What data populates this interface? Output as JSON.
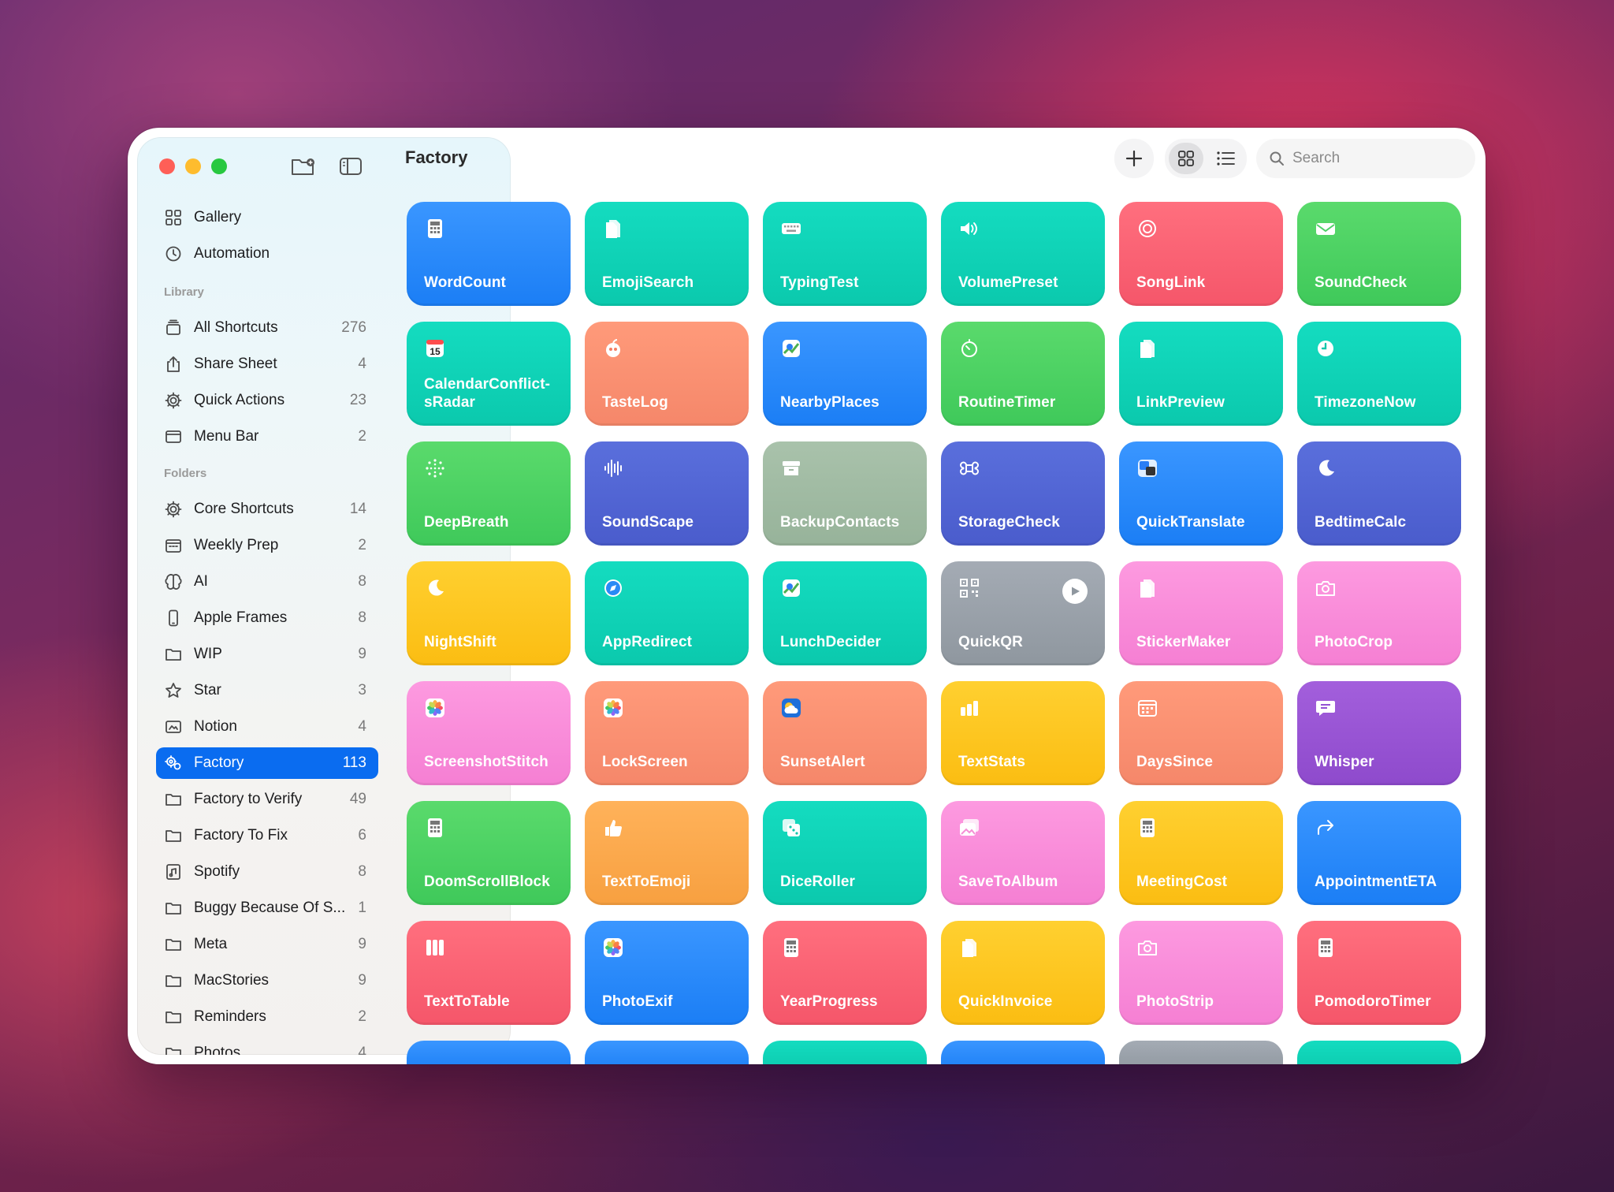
{
  "window": {
    "title": "Factory"
  },
  "toolbar": {
    "search_placeholder": "Search"
  },
  "sidebar": {
    "top": [
      {
        "label": "Gallery",
        "icon": "gallery-icon"
      },
      {
        "label": "Automation",
        "icon": "automation-icon"
      }
    ],
    "library_header": "Library",
    "library": [
      {
        "label": "All Shortcuts",
        "count": "276",
        "icon": "stack-icon"
      },
      {
        "label": "Share Sheet",
        "count": "4",
        "icon": "share-icon"
      },
      {
        "label": "Quick Actions",
        "count": "23",
        "icon": "gear-icon"
      },
      {
        "label": "Menu Bar",
        "count": "2",
        "icon": "window-icon"
      }
    ],
    "folders_header": "Folders",
    "folders": [
      {
        "label": "Core Shortcuts",
        "count": "14",
        "icon": "gear-icon"
      },
      {
        "label": "Weekly Prep",
        "count": "2",
        "icon": "calendar-icon"
      },
      {
        "label": "AI",
        "count": "8",
        "icon": "brain-icon"
      },
      {
        "label": "Apple Frames",
        "count": "8",
        "icon": "phone-icon"
      },
      {
        "label": "WIP",
        "count": "9",
        "icon": "folder-icon"
      },
      {
        "label": "Star",
        "count": "3",
        "icon": "star-icon"
      },
      {
        "label": "Notion",
        "count": "4",
        "icon": "notion-icon"
      },
      {
        "label": "Factory",
        "count": "113",
        "icon": "gears-icon",
        "selected": true
      },
      {
        "label": "Factory to Verify",
        "count": "49",
        "icon": "folder-icon"
      },
      {
        "label": "Factory To Fix",
        "count": "6",
        "icon": "folder-icon"
      },
      {
        "label": "Spotify",
        "count": "8",
        "icon": "music-icon"
      },
      {
        "label": "Buggy Because Of S...",
        "count": "1",
        "icon": "folder-icon"
      },
      {
        "label": "Meta",
        "count": "9",
        "icon": "folder-icon"
      },
      {
        "label": "MacStories",
        "count": "9",
        "icon": "folder-icon"
      },
      {
        "label": "Reminders",
        "count": "2",
        "icon": "folder-icon"
      },
      {
        "label": "Photos",
        "count": "4",
        "icon": "folder-icon"
      }
    ]
  },
  "shortcuts": [
    {
      "name": "WordCount",
      "color": "blue",
      "icon": "calculator-icon"
    },
    {
      "name": "EmojiSearch",
      "color": "teal",
      "icon": "document-icon"
    },
    {
      "name": "TypingTest",
      "color": "teal",
      "icon": "keyboard-icon"
    },
    {
      "name": "VolumePreset",
      "color": "teal",
      "icon": "speaker-icon"
    },
    {
      "name": "SongLink",
      "color": "coral",
      "icon": "target-icon"
    },
    {
      "name": "SoundCheck",
      "color": "green",
      "icon": "envelope-icon"
    },
    {
      "name": "CalendarConflict-sRadar",
      "color": "teal",
      "icon": "calendar-icon",
      "icon_text": "15"
    },
    {
      "name": "TasteLog",
      "color": "salmon",
      "icon": "apple-icon"
    },
    {
      "name": "NearbyPlaces",
      "color": "blue",
      "icon": "maps-icon"
    },
    {
      "name": "RoutineTimer",
      "color": "green",
      "icon": "timer-icon"
    },
    {
      "name": "LinkPreview",
      "color": "teal",
      "icon": "document-icon"
    },
    {
      "name": "TimezoneNow",
      "color": "teal",
      "icon": "clock-icon"
    },
    {
      "name": "DeepBreath",
      "color": "green",
      "icon": "breath-icon"
    },
    {
      "name": "SoundScape",
      "color": "indigo",
      "icon": "waveform-icon"
    },
    {
      "name": "BackupContacts",
      "color": "sage",
      "icon": "archive-icon"
    },
    {
      "name": "StorageCheck",
      "color": "indigo",
      "icon": "command-icon"
    },
    {
      "name": "QuickTranslate",
      "color": "blue",
      "icon": "translate-icon"
    },
    {
      "name": "BedtimeCalc",
      "color": "indigo",
      "icon": "moon-icon"
    },
    {
      "name": "NightShift",
      "color": "yellow",
      "icon": "moon-icon"
    },
    {
      "name": "AppRedirect",
      "color": "teal",
      "icon": "safari-icon"
    },
    {
      "name": "LunchDecider",
      "color": "teal",
      "icon": "maps-icon"
    },
    {
      "name": "QuickQR",
      "color": "gray",
      "icon": "qrcode-icon",
      "play": true
    },
    {
      "name": "StickerMaker",
      "color": "pink",
      "icon": "document-icon"
    },
    {
      "name": "PhotoCrop",
      "color": "pink",
      "icon": "camera-icon"
    },
    {
      "name": "ScreenshotStitch",
      "color": "pink",
      "icon": "photos-icon"
    },
    {
      "name": "LockScreen",
      "color": "salmon",
      "icon": "photos-icon"
    },
    {
      "name": "SunsetAlert",
      "color": "salmon",
      "icon": "weather-icon"
    },
    {
      "name": "TextStats",
      "color": "yellow",
      "icon": "barchart-icon"
    },
    {
      "name": "DaysSince",
      "color": "salmon",
      "icon": "calendar-grid-icon"
    },
    {
      "name": "Whisper",
      "color": "purple",
      "icon": "speech-bubble-icon"
    },
    {
      "name": "DoomScrollBlock",
      "color": "green",
      "icon": "calculator-icon"
    },
    {
      "name": "TextToEmoji",
      "color": "orange",
      "icon": "thumbsup-icon"
    },
    {
      "name": "DiceRoller",
      "color": "teal",
      "icon": "dice-icon"
    },
    {
      "name": "SaveToAlbum",
      "color": "pink",
      "icon": "images-icon"
    },
    {
      "name": "MeetingCost",
      "color": "yellow",
      "icon": "calculator-icon"
    },
    {
      "name": "AppointmentETA",
      "color": "blue",
      "icon": "arrow-turn-icon"
    },
    {
      "name": "TextToTable",
      "color": "coral",
      "icon": "columns-icon"
    },
    {
      "name": "PhotoExif",
      "color": "blue",
      "icon": "photos-icon"
    },
    {
      "name": "YearProgress",
      "color": "coral",
      "icon": "calculator-icon"
    },
    {
      "name": "QuickInvoice",
      "color": "yellow",
      "icon": "document-icon"
    },
    {
      "name": "PhotoStrip",
      "color": "pink",
      "icon": "camera-icon"
    },
    {
      "name": "PomodoroTimer",
      "color": "coral",
      "icon": "calculator-icon"
    }
  ],
  "partial_row_colors": [
    "blue",
    "blue",
    "teal",
    "blue",
    "gray",
    "teal"
  ]
}
